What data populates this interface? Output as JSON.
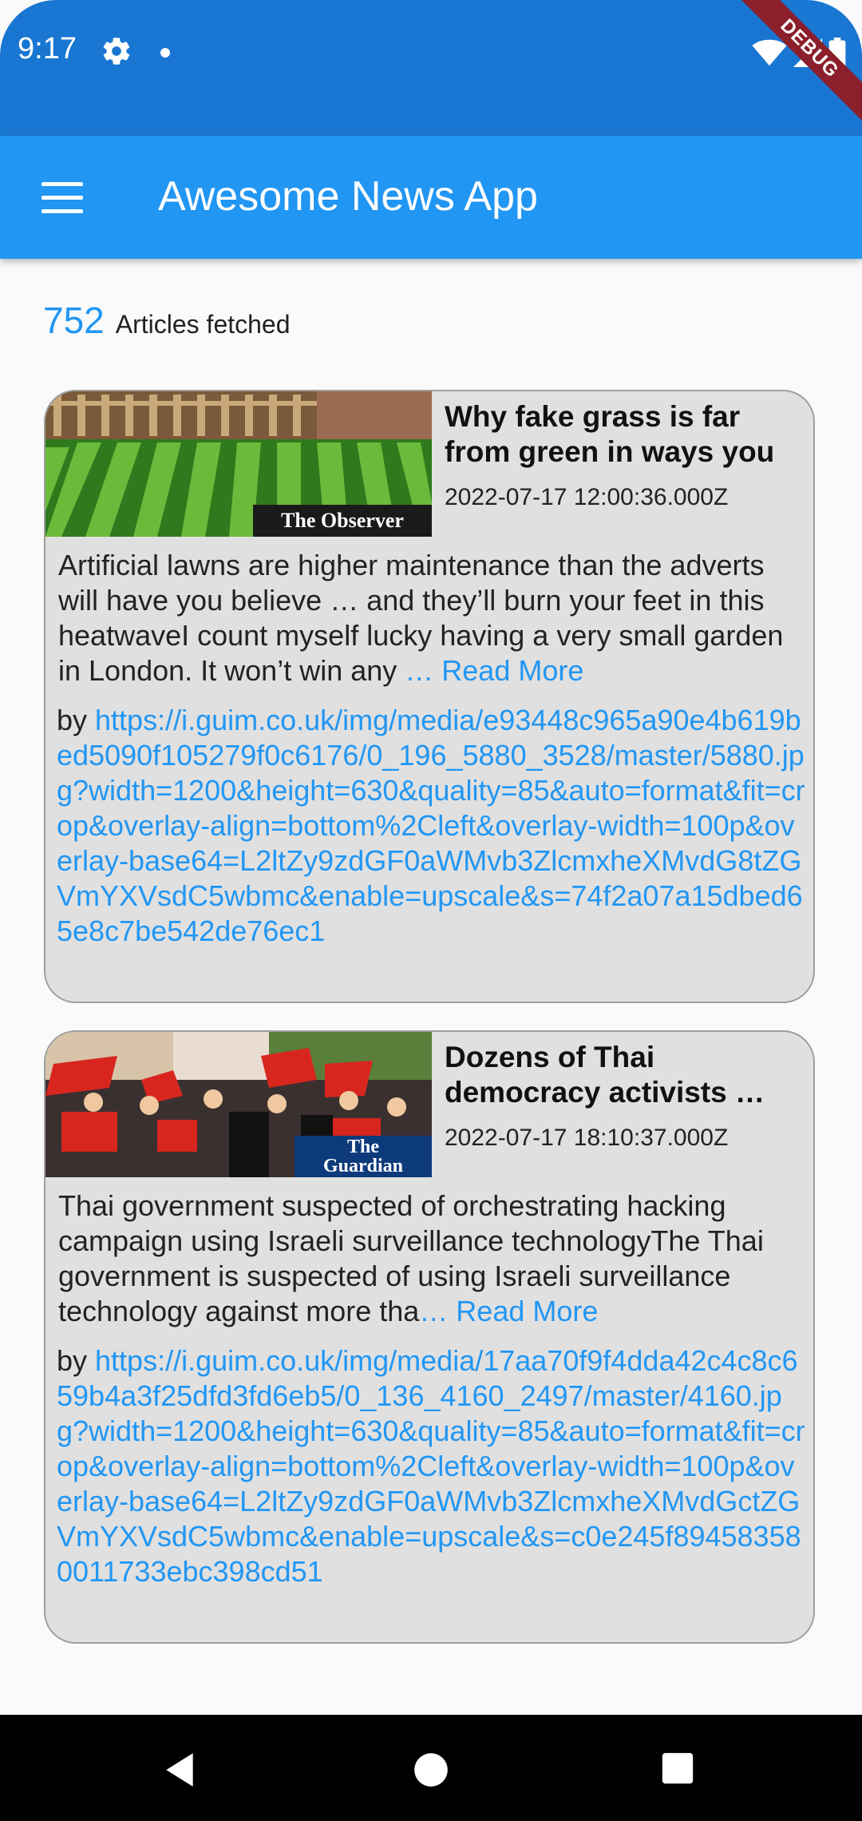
{
  "status_bar": {
    "time": "9:17",
    "debug_label": "DEBUG"
  },
  "app_bar": {
    "title": "Awesome News App"
  },
  "summary": {
    "count": "752",
    "label": "Articles fetched"
  },
  "articles": [
    {
      "title": "Why fake grass is far from green in ways you …",
      "date": "2022-07-17 12:00:36.000Z",
      "description": "Artificial lawns are higher maintenance than the adverts will have you believe … and they’ll burn your feet in this heatwaveI count myself lucky having a very small garden in London. It won’t win any",
      "read_more": "… Read More",
      "by": "by ",
      "url": "https://i.guim.co.uk/img/media/e93448c965a90e4b619bed5090f105279f0c6176/0_196_5880_3528/master/5880.jpg?width=1200&height=630&quality=85&auto=format&fit=crop&overlay-align=bottom%2Cleft&overlay-width=100p&overlay-base64=L2ltZy9zdGF0aWMvb3ZlcmxheXMvdG8tZGVmYXVsdC5wbmc&enable=upscale&s=74f2a07a15dbed65e8c7be542de76ec1",
      "source_badge": "The Observer"
    },
    {
      "title": "Dozens of Thai democracy activists …",
      "date": "2022-07-17 18:10:37.000Z",
      "description": "Thai government suspected of orchestrating hacking campaign using Israeli surveillance technologyThe Thai government is suspected of using Israeli surveillance technology against more tha",
      "read_more": "… Read More",
      "by": "by ",
      "url": "https://i.guim.co.uk/img/media/17aa70f9f4dda42c4c8c659b4a3f25dfd3fd6eb5/0_136_4160_2497/master/4160.jpg?width=1200&height=630&quality=85&auto=format&fit=crop&overlay-align=bottom%2Cleft&overlay-width=100p&overlay-base64=L2ltZy9zdGF0aWMvb3ZlcmxheXMvdGctZGVmYXVsdC5wbmc&enable=upscale&s=c0e245f894583580011733ebc398cd51",
      "source_badge_line1": "The",
      "source_badge_line2": "Guardian"
    }
  ],
  "colors": {
    "status_bar": "#1976d2",
    "app_bar": "#2196f3",
    "link": "#2196f3",
    "card": "#e0e0e0"
  }
}
